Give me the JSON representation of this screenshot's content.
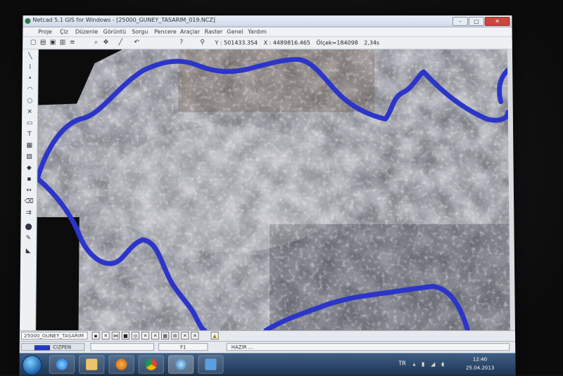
{
  "window": {
    "title": "Netcad 5.1 GIS for Windows - [25000_GUNEY_TASARIM_019.NCZ]",
    "buttons": [
      "–",
      "□",
      "✕"
    ]
  },
  "menu": {
    "items": [
      "Proje",
      "Çiz",
      "Düzenle",
      "Görüntü",
      "Sorgu",
      "Pencere",
      "Araçlar",
      "Raster",
      "Genel",
      "Yardım"
    ]
  },
  "toolbar": {
    "icons": [
      "new-icon",
      "open-icon",
      "save-icon",
      "print-icon",
      "layers-icon",
      "zoom-icon",
      "pan-icon",
      "line-icon",
      "undo-icon",
      "help-icon",
      "query-icon"
    ],
    "y_readout": "Y : 501433.354",
    "x_readout": "X : 4489816.465",
    "scale_readout": "Ölçek=184098",
    "extra_readout": "2,34s"
  },
  "map": {
    "boundary_color": "#2b35c9"
  },
  "statusbar": {
    "drawing_tab": "25000_GUNEY_TASARIM",
    "layer_name": "CIZPEN",
    "layer_color": "#2438c0",
    "function_key": "F1",
    "status_text": "HAZIR ..."
  },
  "taskbar": {
    "language": "TR",
    "time": "12:40",
    "date": "25.04.2013"
  }
}
